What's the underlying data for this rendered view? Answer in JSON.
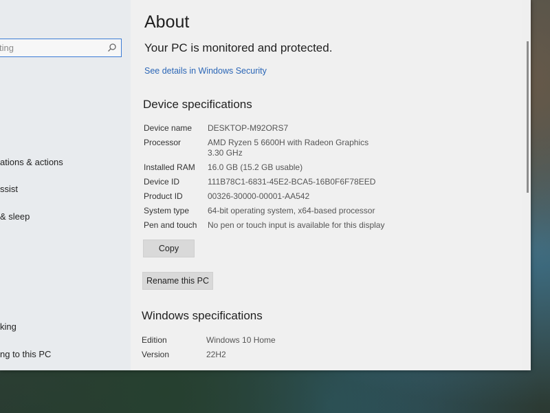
{
  "sidebar": {
    "search_placeholder": "ting",
    "items": [
      {
        "label": "ations & actions"
      },
      {
        "label": "ssist"
      },
      {
        "label": "& sleep"
      },
      {
        "label": "king"
      },
      {
        "label": "ng to this PC"
      }
    ]
  },
  "about": {
    "title": "About",
    "status": "Your PC is monitored and protected.",
    "security_link": "See details in Windows Security"
  },
  "device_specs": {
    "heading": "Device specifications",
    "rows": [
      {
        "label": "Device name",
        "value": "DESKTOP-M92ORS7"
      },
      {
        "label": "Processor",
        "value": "AMD Ryzen 5 6600H with Radeon Graphics",
        "value2": "3.30 GHz"
      },
      {
        "label": "Installed RAM",
        "value": "16.0 GB (15.2 GB usable)"
      },
      {
        "label": "Device ID",
        "value": "111B78C1-6831-45E2-BCA5-16B0F6F78EED"
      },
      {
        "label": "Product ID",
        "value": "00326-30000-00001-AA542"
      },
      {
        "label": "System type",
        "value": "64-bit operating system, x64-based processor"
      },
      {
        "label": "Pen and touch",
        "value": "No pen or touch input is available for this display"
      }
    ],
    "copy_label": "Copy",
    "rename_label": "Rename this PC"
  },
  "windows_specs": {
    "heading": "Windows specifications",
    "rows": [
      {
        "label": "Edition",
        "value": "Windows 10 Home"
      },
      {
        "label": "Version",
        "value": "22H2"
      }
    ]
  },
  "icons": {
    "search": "search-icon"
  },
  "colors": {
    "accent": "#3a7bd5",
    "link": "#2b66b6",
    "button": "#d9d9d9"
  }
}
